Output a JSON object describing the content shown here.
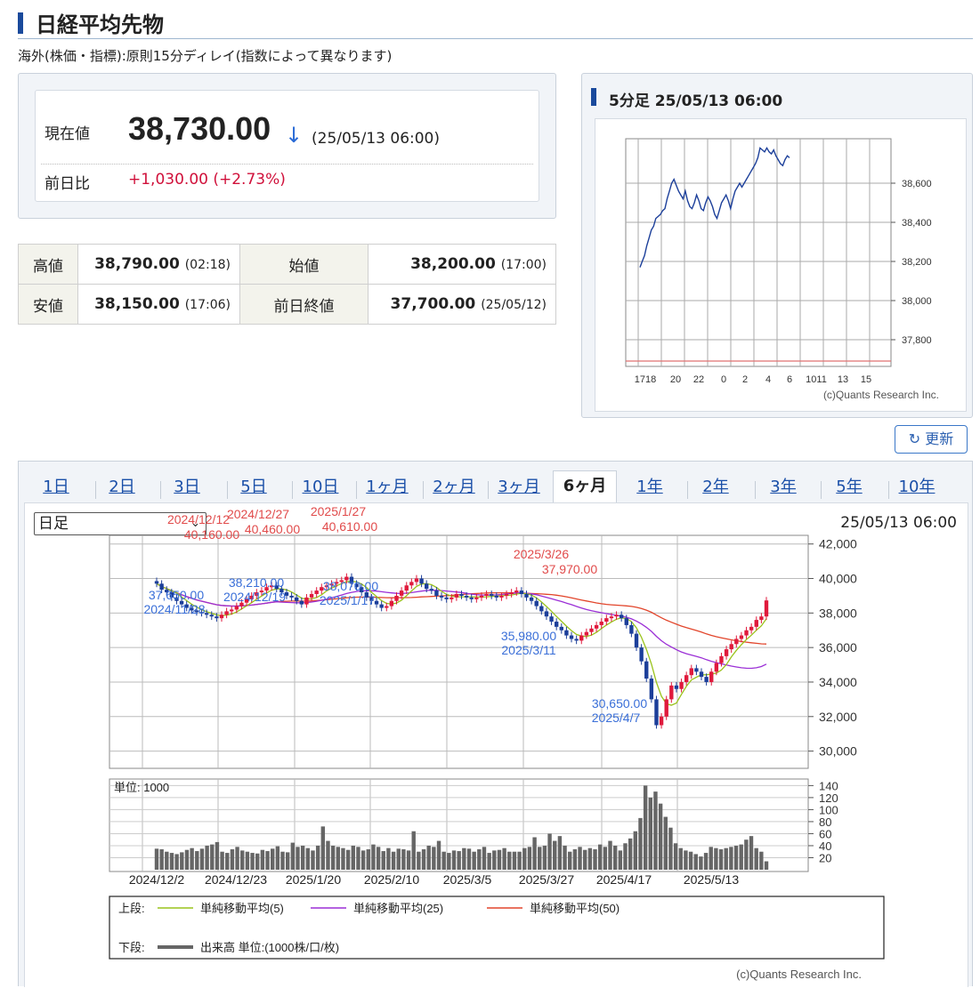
{
  "header": {
    "title": "日経平均先物",
    "subtitle": "海外(株価・指標):原則15分ディレイ(指数によって異なります)"
  },
  "quote": {
    "current_label": "現在値",
    "current_value": "38,730.00",
    "arrow": "↓",
    "current_time": "(25/05/13 06:00)",
    "change_label": "前日比",
    "change_value": "+1,030.00 (+2.73%)"
  },
  "ohlc": {
    "high_label": "高値",
    "high_value": "38,790.00",
    "high_time": "(02:18)",
    "open_label": "始値",
    "open_value": "38,200.00",
    "open_time": "(17:00)",
    "low_label": "安値",
    "low_value": "38,150.00",
    "low_time": "(17:06)",
    "prev_label": "前日終値",
    "prev_value": "37,700.00",
    "prev_time": "(25/05/12)"
  },
  "mini_chart": {
    "title": "5分足 25/05/13 06:00",
    "y_ticks": [
      "38,600",
      "38,400",
      "38,200",
      "38,000",
      "37,800"
    ],
    "x_ticks": [
      "1718",
      "20",
      "22",
      "0",
      "2",
      "4",
      "6",
      "1011",
      "13",
      "15"
    ],
    "credit": "(c)Quants Research Inc.",
    "line_color": "#1c3f9a"
  },
  "refresh_label": "更新",
  "tabs": [
    "1日",
    "2日",
    "3日",
    "5日",
    "10日",
    "1ヶ月",
    "2ヶ月",
    "3ヶ月",
    "6ヶ月",
    "1年",
    "2年",
    "3年",
    "5年",
    "10年"
  ],
  "active_tab": "6ヶ月",
  "chart_controls": {
    "period_select": "日足",
    "timestamp": "25/05/13 06:00"
  },
  "chart_data": {
    "type": "candlestick",
    "y_ticks": [
      "42,000",
      "40,000",
      "38,000",
      "36,000",
      "34,000",
      "32,000",
      "30,000"
    ],
    "ylim": [
      29000,
      42500
    ],
    "x_labels": [
      "2024/12/2",
      "2024/12/23",
      "2025/1/20",
      "2025/2/10",
      "2025/3/5",
      "2025/3/27",
      "2025/4/17",
      "2025/5/13"
    ],
    "annotations_high": [
      {
        "date": "2024/12/12",
        "value": "40,160.00"
      },
      {
        "date": "2024/12/27",
        "value": "40,460.00"
      },
      {
        "date": "2025/1/27",
        "value": "40,610.00"
      },
      {
        "date": "2025/3/26",
        "value": "37,970.00"
      }
    ],
    "annotations_low": [
      {
        "date": "2024/11/28",
        "value": "37,650.00"
      },
      {
        "date": "2024/12/19",
        "value": "38,210.00"
      },
      {
        "date": "2025/1/17",
        "value": "38,070.00"
      },
      {
        "date": "2025/3/11",
        "value": "35,980.00"
      },
      {
        "date": "2025/4/7",
        "value": "30,650.00"
      }
    ],
    "closes": [
      39700,
      39350,
      39200,
      38900,
      38700,
      38500,
      38300,
      38150,
      38050,
      38000,
      37900,
      37800,
      37700,
      37900,
      38100,
      38200,
      38400,
      38600,
      38800,
      39000,
      39200,
      39300,
      39500,
      39600,
      39400,
      39200,
      39000,
      38900,
      38700,
      38500,
      38900,
      39100,
      39300,
      39500,
      39600,
      39700,
      39800,
      39900,
      40100,
      39700,
      39500,
      39200,
      38900,
      38700,
      38500,
      38300,
      38400,
      38700,
      39000,
      39300,
      39600,
      39800,
      40000,
      39700,
      39400,
      39300,
      39000,
      38900,
      38800,
      38900,
      39100,
      39000,
      38900,
      38800,
      38900,
      39000,
      39100,
      39000,
      38900,
      39000,
      39100,
      39200,
      39300,
      39100,
      38900,
      38700,
      38400,
      38100,
      37800,
      37500,
      37200,
      37000,
      36700,
      36500,
      36400,
      36700,
      36900,
      37100,
      37300,
      37500,
      37700,
      37800,
      37900,
      37700,
      37300,
      36800,
      36000,
      35200,
      34200,
      33000,
      31500,
      32000,
      33000,
      33800,
      33600,
      34000,
      34400,
      34800,
      34600,
      34300,
      34000,
      34600,
      35100,
      35500,
      35900,
      36200,
      36500,
      36700,
      37000,
      37200,
      37600,
      37800,
      38730
    ],
    "sma5": "overlay",
    "sma25": "overlay",
    "sma50": "overlay",
    "volume": {
      "unit_label": "単位: 1000",
      "y_ticks": [
        "140",
        "120",
        "100",
        "80",
        "60",
        "40",
        "20"
      ],
      "values": [
        35,
        34,
        30,
        28,
        26,
        29,
        33,
        36,
        31,
        35,
        40,
        42,
        46,
        30,
        28,
        34,
        38,
        32,
        30,
        28,
        27,
        33,
        31,
        35,
        39,
        30,
        29,
        45,
        38,
        40,
        36,
        32,
        40,
        72,
        48,
        40,
        38,
        36,
        33,
        40,
        38,
        32,
        34,
        42,
        38,
        31,
        36,
        30,
        35,
        34,
        32,
        64,
        30,
        34,
        40,
        38,
        48,
        30,
        28,
        32,
        31,
        36,
        35,
        30,
        34,
        38,
        28,
        32,
        33,
        36,
        30,
        30,
        30,
        36,
        38,
        54,
        38,
        40,
        60,
        48,
        56,
        40,
        30,
        34,
        38,
        33,
        36,
        34,
        42,
        38,
        48,
        40,
        32,
        44,
        52,
        64,
        86,
        140,
        120,
        130,
        110,
        88,
        70,
        44,
        36,
        32,
        30,
        26,
        22,
        28,
        38,
        36,
        34,
        36,
        38,
        40,
        42,
        50,
        56,
        36,
        30,
        14
      ]
    },
    "legend": [
      {
        "label": "単純移動平均(5)",
        "color": "#9ac31c"
      },
      {
        "label": "単純移動平均(25)",
        "color": "#9b2fd6"
      },
      {
        "label": "単純移動平均(50)",
        "color": "#e2452b"
      }
    ],
    "legend_top_label": "上段:",
    "legend_bottom_label": "下段:",
    "legend_volume_label": "出来高 単位:(1000株/口/枚)",
    "credit": "(c)Quants Research Inc.",
    "up_color": "#e01a3c",
    "down_color": "#1c3f9a"
  }
}
